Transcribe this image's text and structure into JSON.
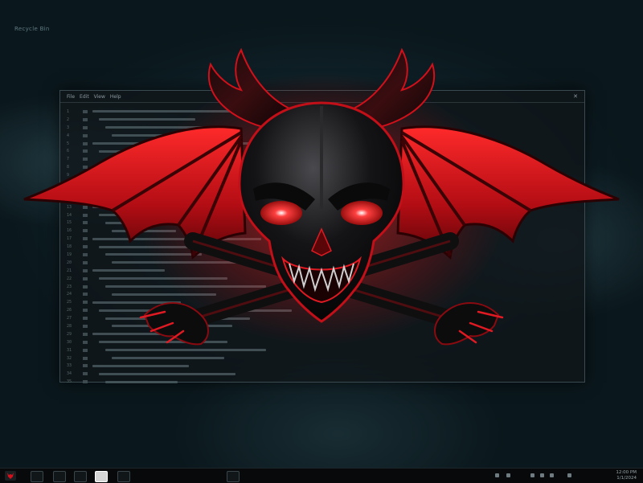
{
  "desktop": {
    "label": "Recycle Bin",
    "background_color": "#0b1a20",
    "accent_color": "#d4121d"
  },
  "window": {
    "menu": [
      "File",
      "Edit",
      "View",
      "Help"
    ],
    "close_label": "✕",
    "line_numbers": [
      "1",
      "2",
      "3",
      "4",
      "5",
      "6",
      "7",
      "8",
      "9",
      "10",
      "11",
      "12",
      "13",
      "14",
      "15",
      "16",
      "17",
      "18",
      "19",
      "20",
      "21",
      "22",
      "23",
      "24",
      "25",
      "26",
      "27",
      "28",
      "29",
      "30",
      "31",
      "32",
      "33",
      "34",
      "35"
    ]
  },
  "emblem": {
    "icon": "horned-skull-bat-wings-icon"
  },
  "taskbar": {
    "start_icon": "devil-start-icon",
    "apps": [
      {
        "name": "files-app-icon"
      },
      {
        "name": "browser-app-icon"
      },
      {
        "name": "chat-app-icon"
      },
      {
        "name": "media-app-icon"
      },
      {
        "name": "terminal-app-icon"
      },
      {
        "name": "pinned-app-icon"
      }
    ],
    "clock": {
      "time": "12:00 PM",
      "date": "1/1/2024"
    }
  }
}
